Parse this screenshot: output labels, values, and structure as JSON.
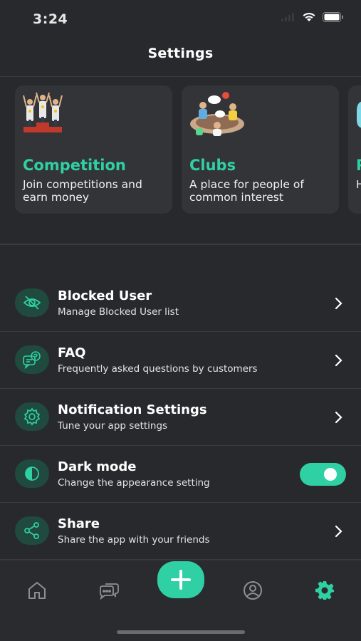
{
  "status_bar": {
    "time": "3:24"
  },
  "header": {
    "title": "Settings"
  },
  "cards": [
    {
      "title": "Competition",
      "description": "Join competitions and earn money",
      "icon": "podium-winners-illustration"
    },
    {
      "title": "Clubs",
      "description": "A place for people of common interest",
      "icon": "club-meeting-illustration"
    },
    {
      "title": "P",
      "description": "H w",
      "icon": "partial-card-illustration"
    }
  ],
  "menu": [
    {
      "title": "Blocked User",
      "subtitle": "Manage Blocked User list",
      "icon": "eye-slash-icon",
      "control": "chevron"
    },
    {
      "title": "FAQ",
      "subtitle": "Frequently asked questions by customers",
      "icon": "faq-icon",
      "control": "chevron"
    },
    {
      "title": "Notification Settings",
      "subtitle": "Tune your app settings",
      "icon": "gear-icon",
      "control": "chevron"
    },
    {
      "title": "Dark mode",
      "subtitle": "Change the appearance setting",
      "icon": "contrast-icon",
      "control": "toggle",
      "toggle_on": true
    },
    {
      "title": "Share",
      "subtitle": "Share the app with your friends",
      "icon": "share-icon",
      "control": "chevron"
    }
  ],
  "tabbar": {
    "tabs": [
      "home-icon",
      "chat-icon",
      "add-icon",
      "profile-icon",
      "settings-icon"
    ],
    "active": "settings-icon"
  },
  "colors": {
    "accent": "#2fd0a4",
    "background": "#28292d",
    "card": "#333438",
    "icon_bg": "#1f4a3d"
  }
}
